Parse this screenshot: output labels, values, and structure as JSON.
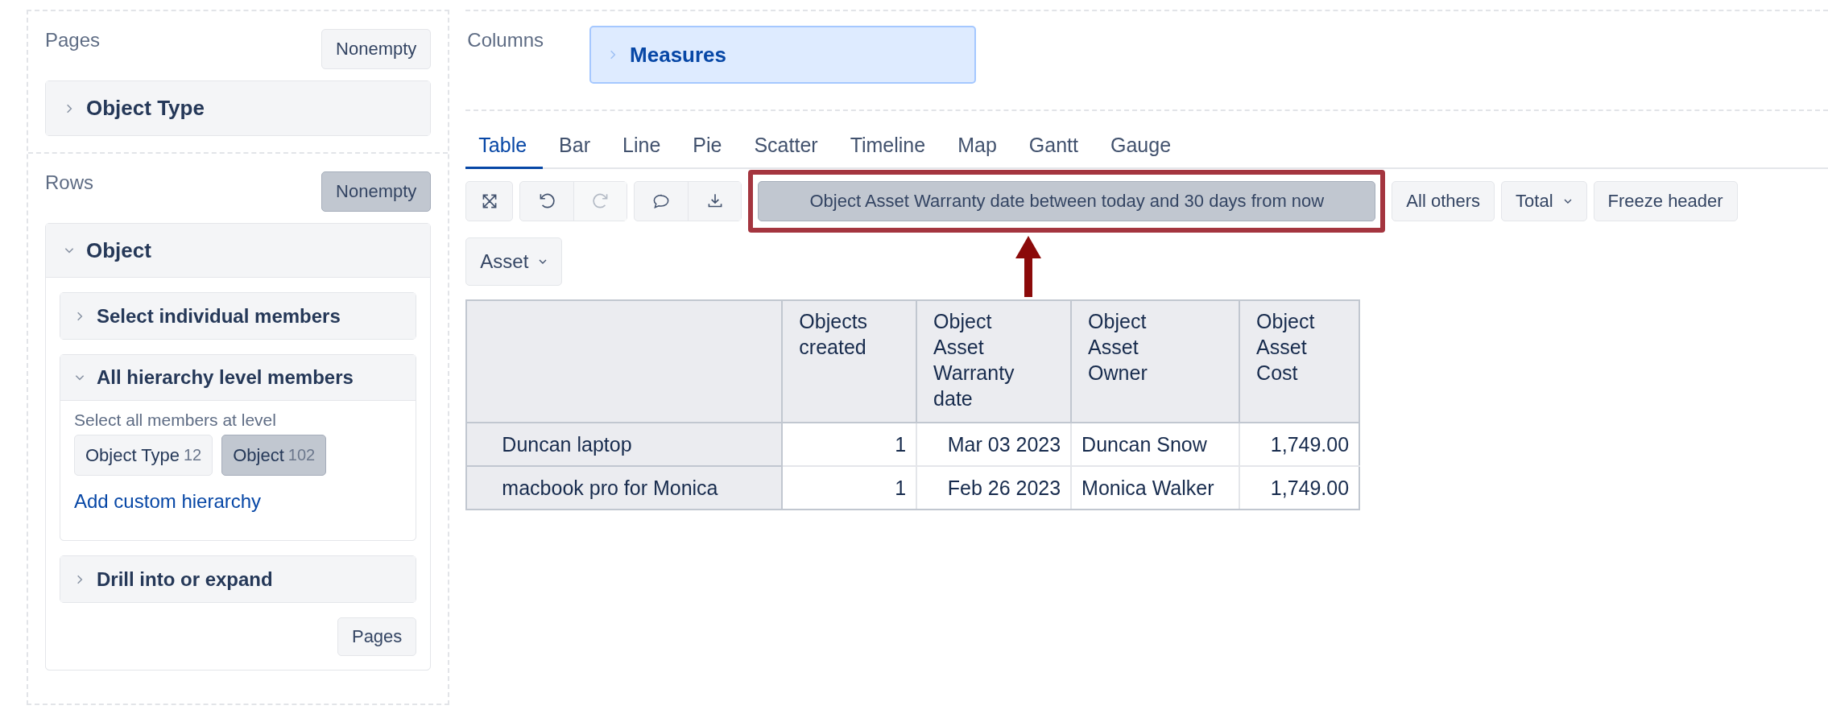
{
  "pages": {
    "title": "Pages",
    "nonempty": {
      "label": "Nonempty",
      "selected": false
    },
    "items": [
      {
        "label": "Object Type",
        "expanded": false
      }
    ]
  },
  "rows": {
    "title": "Rows",
    "nonempty": {
      "label": "Nonempty",
      "selected": true
    },
    "dimension": {
      "label": "Object",
      "expanded": true,
      "options": [
        {
          "label": "Select individual members",
          "expanded": false
        },
        {
          "label": "All hierarchy level members",
          "expanded": true,
          "hint": "Select all members at level",
          "levels": [
            {
              "name": "Object Type",
              "count": "12",
              "selected": false
            },
            {
              "name": "Object",
              "count": "102",
              "selected": true
            }
          ],
          "link": "Add custom hierarchy"
        },
        {
          "label": "Drill into or expand",
          "expanded": false
        }
      ],
      "button": "Pages"
    }
  },
  "columns": {
    "title": "Columns",
    "items": [
      {
        "label": "Measures",
        "expanded": false
      }
    ]
  },
  "tabs": [
    {
      "label": "Table",
      "selected": true
    },
    {
      "label": "Bar",
      "selected": false
    },
    {
      "label": "Line",
      "selected": false
    },
    {
      "label": "Pie",
      "selected": false
    },
    {
      "label": "Scatter",
      "selected": false
    },
    {
      "label": "Timeline",
      "selected": false
    },
    {
      "label": "Map",
      "selected": false
    },
    {
      "label": "Gantt",
      "selected": false
    },
    {
      "label": "Gauge",
      "selected": false
    }
  ],
  "tool_groups": [
    {
      "buttons": [
        {
          "kind": "fullscreen",
          "disabled": false
        }
      ]
    },
    {
      "buttons": [
        {
          "kind": "undo",
          "disabled": false
        },
        {
          "kind": "redo",
          "disabled": true
        }
      ]
    },
    {
      "buttons": [
        {
          "kind": "comment",
          "disabled": false
        },
        {
          "kind": "download",
          "disabled": false
        }
      ]
    }
  ],
  "filter": {
    "label": "Object Asset Warranty date between today and 30 days from now",
    "selected": true,
    "highlighted": true
  },
  "toolbar_buttons": [
    {
      "label": "All others",
      "kind": "button",
      "selected": false
    },
    {
      "label": "Total",
      "kind": "dropdown",
      "selected": false
    },
    {
      "label": "Freeze header",
      "kind": "button",
      "selected": false
    }
  ],
  "dimension_dropdown": {
    "label": "Asset"
  },
  "table": {
    "columns": [
      "Objects created",
      "Object Asset Warranty date",
      "Object Asset Owner",
      "Object Asset Cost"
    ],
    "rows": [
      {
        "label": "Duncan laptop",
        "cells": [
          "1",
          "Mar 03 2023",
          "Duncan Snow",
          "1,749.00"
        ]
      },
      {
        "label": "macbook pro for Monica",
        "cells": [
          "1",
          "Feb 26 2023",
          "Monica Walker",
          "1,749.00"
        ]
      }
    ]
  }
}
